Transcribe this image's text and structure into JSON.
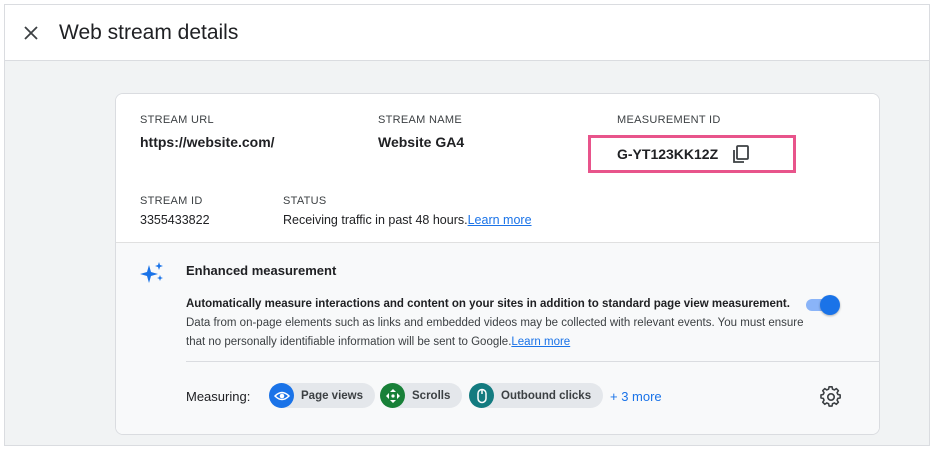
{
  "header": {
    "title": "Web stream details",
    "close_icon": "close-icon"
  },
  "stream": {
    "url_label": "STREAM URL",
    "url_value": "https://website.com/",
    "name_label": "STREAM NAME",
    "name_value": "Website GA4",
    "measurement_label": "MEASUREMENT ID",
    "measurement_value": "G-YT123KK12Z",
    "id_label": "STREAM ID",
    "id_value": "3355433822",
    "status_label": "STATUS",
    "status_value": "Receiving traffic in past 48 hours.",
    "status_link": "Learn more"
  },
  "enhanced": {
    "title": "Enhanced measurement",
    "desc_bold": "Automatically measure interactions and content on your sites in addition to standard page view measurement.",
    "desc_rest": "Data from on-page elements such as links and embedded videos may be collected with relevant events. You must ensure that no personally identifiable information will be sent to Google.",
    "desc_link": "Learn more",
    "toggle_on": true,
    "measuring_label": "Measuring:",
    "chips": [
      {
        "label": "Page views",
        "icon": "eye-icon",
        "color": "#1a73e8"
      },
      {
        "label": "Scrolls",
        "icon": "scroll-icon",
        "color": "#188038"
      },
      {
        "label": "Outbound clicks",
        "icon": "mouse-icon",
        "color": "#137b80"
      }
    ],
    "more_label": "+ 3 more"
  },
  "colors": {
    "accent": "#1a73e8",
    "highlight_border": "#e8548b"
  }
}
